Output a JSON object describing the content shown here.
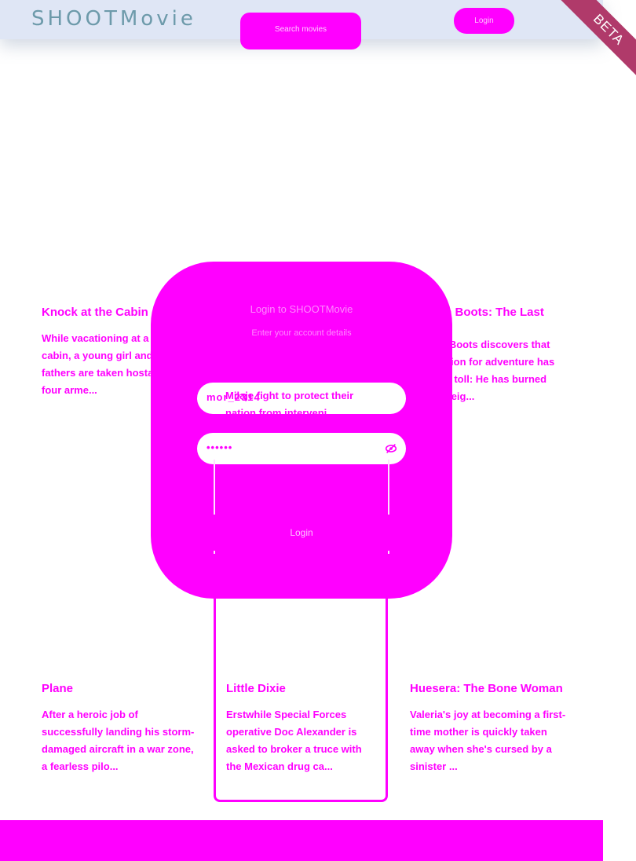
{
  "header": {
    "brand": "SHOOTMovie",
    "search_button": "Search movies",
    "login_button": "Login"
  },
  "ribbon": {
    "label": "BETA"
  },
  "movies": [
    {
      "title": "Knock at the Cabin",
      "desc": "While vacationing at a remote cabin, a young girl and her two fathers are taken hostage by four arme..."
    },
    {
      "title": "Puss in Boots: The Last",
      "desc": "Puss in Boots discovers that his passion for adventure has taken its toll: He has burned through eig..."
    },
    {
      "title": "Plane",
      "desc": "After a heroic job of successfully landing his storm-damaged aircraft in a war zone, a fearless pilo..."
    },
    {
      "title": "Little Dixie",
      "desc": "Erstwhile Special Forces operative Doc Alexander is asked to broker a truce with the Mexican drug ca..."
    },
    {
      "title": "Huesera: The Bone Woman",
      "desc": "Valeria's joy at becoming a first-time mother is quickly taken away when she's cursed by a sinister ..."
    }
  ],
  "hidden_card": {
    "desc_overlap": "Milaje fight to protect their nation from interveni..."
  },
  "login": {
    "title": "Login to SHOOTMovie",
    "subtitle": "Enter your account details",
    "username_value": "mor_2314",
    "password_value": "••••••",
    "submit_label": "Login"
  },
  "colors": {
    "accent": "#ff00ff",
    "header_bg": "#dfe6f5",
    "ribbon": "#b03a6a",
    "brand": "#6d9aaa"
  }
}
